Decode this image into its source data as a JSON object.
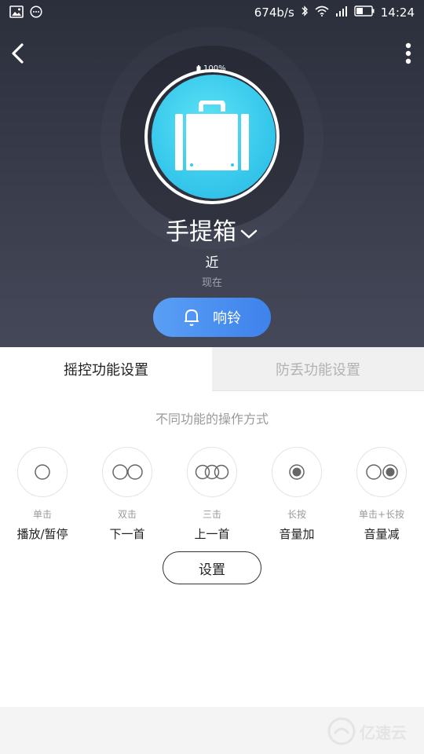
{
  "status_bar": {
    "speed": "674b/s",
    "time": "14:24",
    "icons": [
      "image-icon",
      "chat-icon",
      "bluetooth-icon",
      "wifi-icon",
      "signal-icon",
      "battery-icon"
    ]
  },
  "header": {
    "back_icon": "chevron-left-icon",
    "menu_icon": "more-vertical-icon"
  },
  "device": {
    "battery_percent": "100%",
    "battery_level": 1.0,
    "icon": "suitcase-icon",
    "name": "手提箱",
    "proximity": "近",
    "last_seen": "现在"
  },
  "ring_button": {
    "label": "响铃",
    "icon": "bell-icon"
  },
  "tabs": [
    {
      "label": "摇控功能设置",
      "active": true
    },
    {
      "label": "防丢功能设置",
      "active": false
    }
  ],
  "section_hint": "不同功能的操作方式",
  "gestures": [
    {
      "type": "单击",
      "action": "播放/暂停",
      "icon": "single-click-icon"
    },
    {
      "type": "双击",
      "action": "下一首",
      "icon": "double-click-icon"
    },
    {
      "type": "三击",
      "action": "上一首",
      "icon": "triple-click-icon"
    },
    {
      "type": "长按",
      "action": "音量加",
      "icon": "long-press-icon"
    },
    {
      "type": "单击+长按",
      "action": "音量减",
      "icon": "click-long-press-icon"
    }
  ],
  "settings_button": {
    "label": "设置"
  },
  "colors": {
    "accent_blue": "#3e82ec",
    "device_cyan": "#37c8ec",
    "hero_dark": "#2b2e3b"
  }
}
